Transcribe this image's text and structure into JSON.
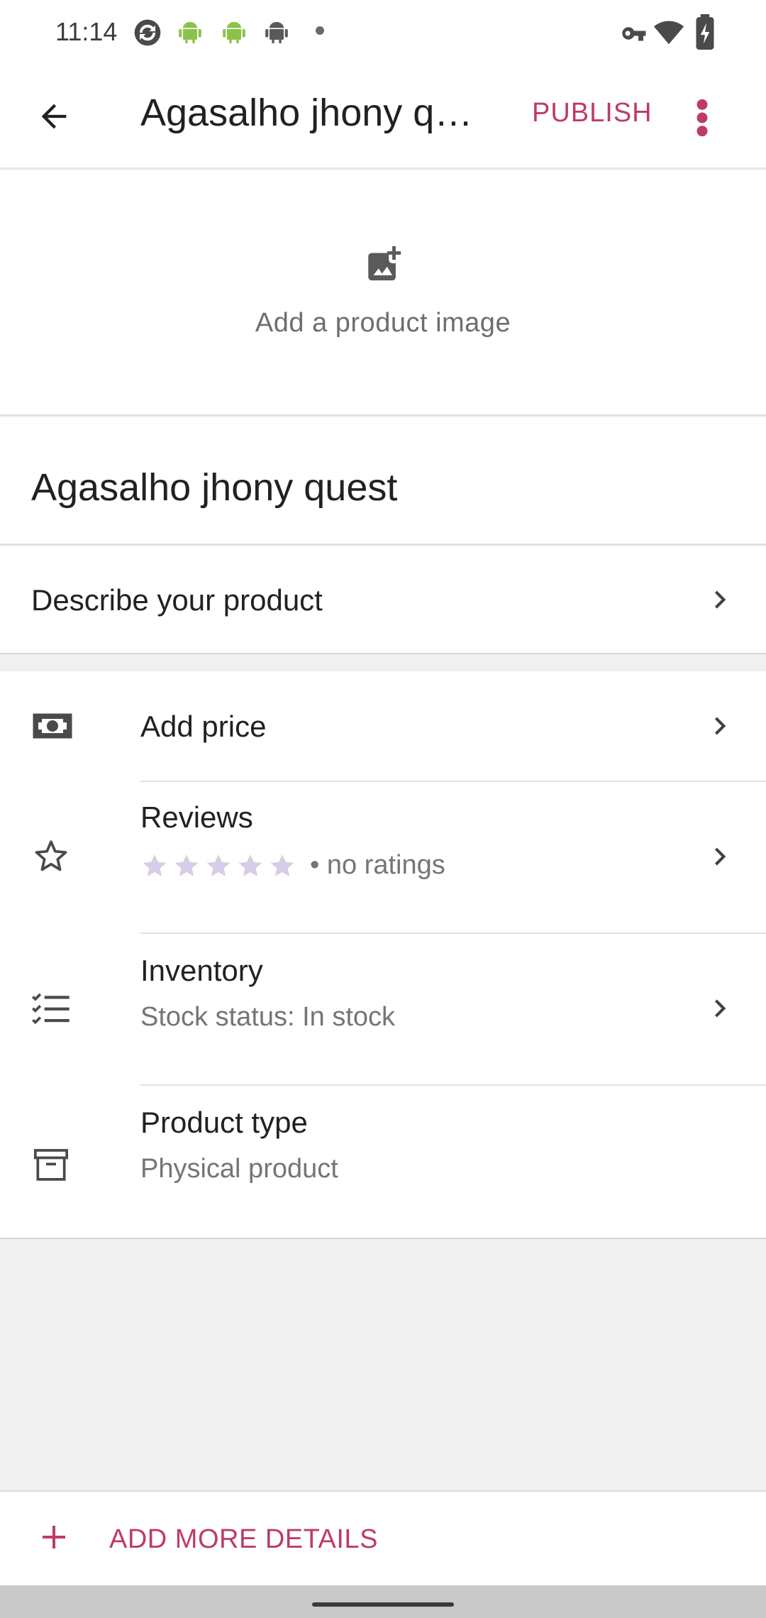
{
  "status_bar": {
    "time": "11:14",
    "icons": [
      "sync-icon",
      "android-icon",
      "android-icon",
      "android-icon",
      "dot-icon",
      "vpn-key-icon",
      "wifi-icon",
      "battery-charging-icon"
    ]
  },
  "app_bar": {
    "title": "Agasalho jhony quest",
    "publish_label": "PUBLISH",
    "accent_color": "#be3a6b"
  },
  "image_area": {
    "label": "Add a product image"
  },
  "product": {
    "name": "Agasalho jhony quest",
    "describe_label": "Describe your product"
  },
  "details": {
    "price": {
      "label": "Add price"
    },
    "reviews": {
      "label": "Reviews",
      "rating_text": "• no ratings",
      "stars_filled": 0,
      "stars_total": 5
    },
    "inventory": {
      "label": "Inventory",
      "value": "Stock status: In stock"
    },
    "product_type": {
      "label": "Product type",
      "value": "Physical product"
    }
  },
  "bottom": {
    "add_more_label": "ADD MORE DETAILS"
  }
}
